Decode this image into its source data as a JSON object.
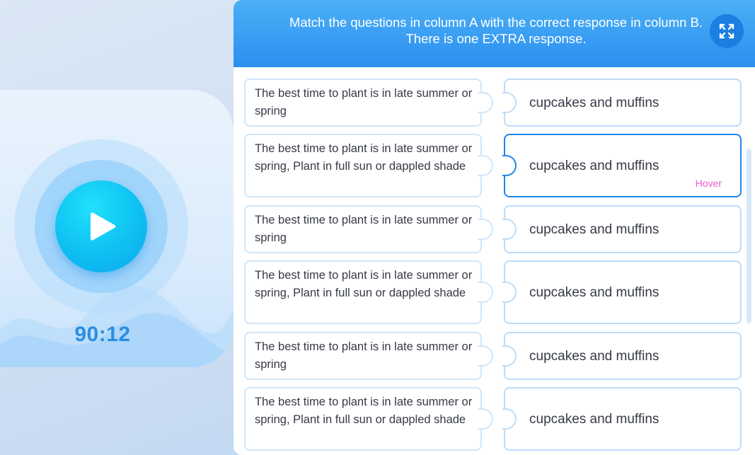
{
  "player": {
    "timer": "90:12",
    "play_icon": "play-icon"
  },
  "header": {
    "instruction": "Match the questions in column A with the correct response in column B. There is one EXTRA response.",
    "expand_icon": "expand-icon"
  },
  "rows": [
    {
      "question": "The best time to plant is in late summer or spring",
      "response": "cupcakes and muffins",
      "state": ""
    },
    {
      "question": "The best time to plant is in late summer or spring, Plant in full sun or dappled shade",
      "response": "cupcakes and muffins",
      "state": "Hover"
    },
    {
      "question": "The best time to plant is in late summer or spring",
      "response": "cupcakes and muffins",
      "state": ""
    },
    {
      "question": "The best time to plant is in late summer or spring, Plant in full sun or dappled shade",
      "response": "cupcakes and muffins",
      "state": ""
    },
    {
      "question": "The best time to plant is in late summer or spring",
      "response": "cupcakes and muffins",
      "state": ""
    },
    {
      "question": "The best time to plant is in late summer or spring, Plant in full sun or dappled shade",
      "response": "cupcakes and muffins",
      "state": ""
    }
  ],
  "colors": {
    "header": "#2b8ff0",
    "play_button": "#11c6f4",
    "timer": "#2a8ee0",
    "hover_border": "#1e86e8",
    "hover_label": "#e95bd6"
  }
}
